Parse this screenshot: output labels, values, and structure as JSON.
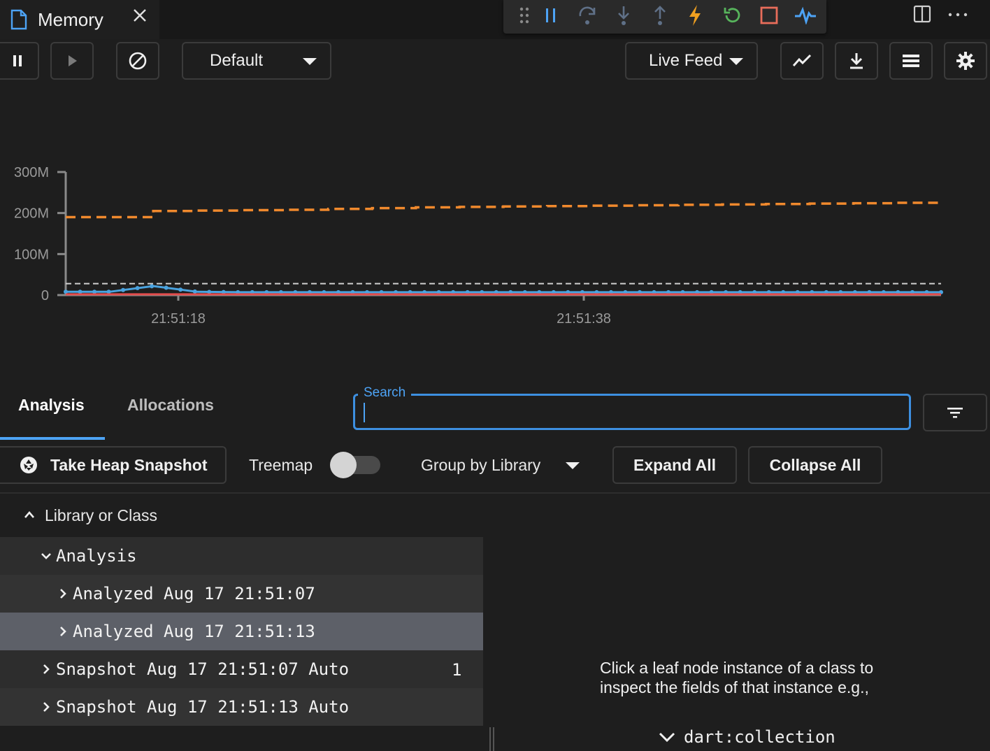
{
  "tab": {
    "title": "Memory",
    "close_icon": "close-icon"
  },
  "debug_toolbar": {
    "icons": [
      "drag-handle-icon",
      "pause-icon",
      "step-over-icon",
      "step-into-icon",
      "step-out-icon",
      "hot-reload-icon",
      "restart-icon",
      "stop-icon",
      "devtools-icon"
    ]
  },
  "toolbar": {
    "profile_dropdown": "Default",
    "feed_dropdown": "Live Feed"
  },
  "chart_data": {
    "type": "line",
    "y_ticks": [
      "300M",
      "200M",
      "100M",
      "0"
    ],
    "x_ticks": [
      "21:51:18",
      "21:51:38"
    ],
    "ylim": [
      0,
      300
    ],
    "series": [
      {
        "style": "orange-dashed",
        "color": "#f0892d",
        "values": [
          190,
          190,
          205,
          206,
          207,
          208,
          210,
          212,
          214,
          215,
          216,
          217,
          218,
          219,
          220,
          221,
          222,
          223,
          224,
          225,
          226
        ]
      },
      {
        "style": "white-dashed",
        "color": "#d0d0d0",
        "values": [
          28,
          28,
          28,
          28,
          28,
          28,
          28,
          28,
          28,
          28,
          28,
          28,
          28,
          28,
          28,
          28,
          28,
          28,
          28,
          28,
          28
        ]
      },
      {
        "style": "blue-line-points",
        "color": "#4aa3df",
        "values": [
          8,
          8,
          22,
          8,
          7,
          7,
          7,
          7,
          7,
          7,
          7,
          7,
          7,
          7,
          7,
          7,
          7,
          7,
          7,
          7,
          7
        ]
      },
      {
        "style": "red-line",
        "color": "#e34c4c",
        "values": [
          2,
          2,
          2,
          2,
          2,
          2,
          2,
          2,
          2,
          2,
          2,
          2,
          2,
          2,
          2,
          2,
          2,
          2,
          2,
          2,
          2
        ]
      }
    ]
  },
  "analysis_tabs": {
    "analysis": "Analysis",
    "allocations": "Allocations"
  },
  "search": {
    "label": "Search",
    "value": ""
  },
  "actions": {
    "take_snapshot": "Take Heap Snapshot",
    "treemap": "Treemap",
    "group_by": "Group by Library",
    "expand_all": "Expand All",
    "collapse_all": "Collapse All"
  },
  "tree": {
    "header": "Library or Class",
    "rows": [
      {
        "label": "Analysis",
        "count": ""
      },
      {
        "label": "Analyzed Aug 17 21:51:07",
        "count": ""
      },
      {
        "label": "Analyzed Aug 17 21:51:13",
        "count": ""
      },
      {
        "label": "Snapshot Aug 17 21:51:07 Auto",
        "count": "1"
      },
      {
        "label": "Snapshot Aug 17 21:51:13 Auto",
        "count": ""
      }
    ]
  },
  "instance_panel": {
    "hint_line1": "Click a leaf node instance of a class to",
    "hint_line2": "inspect the fields of that instance e.g.,",
    "example": "dart:collection"
  }
}
